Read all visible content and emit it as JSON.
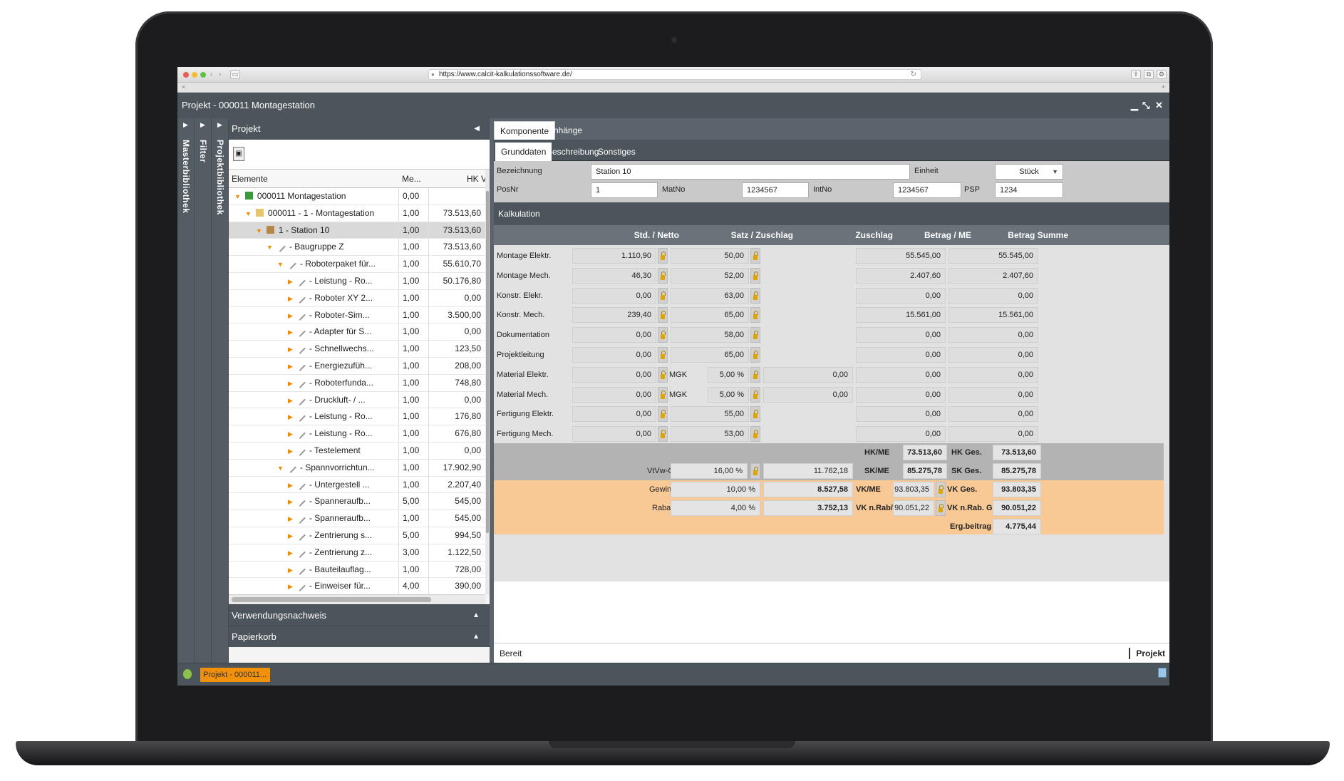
{
  "browser": {
    "url": "https://www.calcit-kalkulationssoftware.de/"
  },
  "window": {
    "title": "Projekt - 000011 Montagestation"
  },
  "side_tabs": [
    "Masterbibliothek",
    "Filter",
    "Projektbibliothek"
  ],
  "left_panel": {
    "title": "Projekt",
    "columns": [
      "Elemente",
      "Me...",
      "HK",
      "V"
    ],
    "rows": [
      {
        "name": "000011 Montagestation",
        "me": "0,00",
        "hk": "",
        "level": 0,
        "expand": "open",
        "icon": "excel-icon"
      },
      {
        "name": "000011 - 1 - Montagestation",
        "me": "1,00",
        "hk": "73.513,60",
        "level": 1,
        "expand": "open",
        "icon": "folder-icon"
      },
      {
        "name": "1 - Station 10",
        "me": "1,00",
        "hk": "73.513,60",
        "level": 2,
        "expand": "open",
        "icon": "station-icon",
        "selected": true
      },
      {
        "name": "- Baugruppe Z",
        "me": "1,00",
        "hk": "73.513,60",
        "level": 3,
        "expand": "open",
        "icon": "wrench-icon"
      },
      {
        "name": "- Roboterpaket für...",
        "me": "1,00",
        "hk": "55.610,70",
        "level": 4,
        "expand": "open",
        "icon": "wrench-icon"
      },
      {
        "name": "- Leistung - Ro...",
        "me": "1,00",
        "hk": "50.176,80",
        "level": 5,
        "expand": "closed",
        "icon": "wrench-icon"
      },
      {
        "name": "- Roboter XY 2...",
        "me": "1,00",
        "hk": "0,00",
        "level": 5,
        "expand": "closed",
        "icon": "wrench-icon"
      },
      {
        "name": "- Roboter-Sim...",
        "me": "1,00",
        "hk": "3.500,00",
        "level": 5,
        "expand": "closed",
        "icon": "wrench-icon"
      },
      {
        "name": "- Adapter für S...",
        "me": "1,00",
        "hk": "0,00",
        "level": 5,
        "expand": "closed",
        "icon": "wrench-icon"
      },
      {
        "name": "- Schnellwechs...",
        "me": "1,00",
        "hk": "123,50",
        "level": 5,
        "expand": "closed",
        "icon": "wrench-icon"
      },
      {
        "name": "- Energiezufüh...",
        "me": "1,00",
        "hk": "208,00",
        "level": 5,
        "expand": "closed",
        "icon": "wrench-icon"
      },
      {
        "name": "- Roboterfunda...",
        "me": "1,00",
        "hk": "748,80",
        "level": 5,
        "expand": "closed",
        "icon": "wrench-icon"
      },
      {
        "name": "- Druckluft- / ...",
        "me": "1,00",
        "hk": "0,00",
        "level": 5,
        "expand": "closed",
        "icon": "wrench-icon"
      },
      {
        "name": "- Leistung - Ro...",
        "me": "1,00",
        "hk": "176,80",
        "level": 5,
        "expand": "closed",
        "icon": "wrench-icon"
      },
      {
        "name": "- Leistung - Ro...",
        "me": "1,00",
        "hk": "676,80",
        "level": 5,
        "expand": "closed",
        "icon": "wrench-icon"
      },
      {
        "name": "- Testelement",
        "me": "1,00",
        "hk": "0,00",
        "level": 5,
        "expand": "closed",
        "icon": "wrench-icon"
      },
      {
        "name": "- Spannvorrichtun...",
        "me": "1,00",
        "hk": "17.902,90",
        "level": 4,
        "expand": "open",
        "icon": "wrench-icon"
      },
      {
        "name": "- Untergestell ...",
        "me": "1,00",
        "hk": "2.207,40",
        "level": 5,
        "expand": "closed",
        "icon": "wrench-icon"
      },
      {
        "name": "- Spanneraufb...",
        "me": "5,00",
        "hk": "545,00",
        "level": 5,
        "expand": "closed",
        "icon": "wrench-icon"
      },
      {
        "name": "- Spanneraufb...",
        "me": "1,00",
        "hk": "545,00",
        "level": 5,
        "expand": "closed",
        "icon": "wrench-icon"
      },
      {
        "name": "- Zentrierung s...",
        "me": "5,00",
        "hk": "994,50",
        "level": 5,
        "expand": "closed",
        "icon": "wrench-icon"
      },
      {
        "name": "- Zentrierung z...",
        "me": "3,00",
        "hk": "1.122,50",
        "level": 5,
        "expand": "closed",
        "icon": "wrench-icon"
      },
      {
        "name": "- Bauteilauflag...",
        "me": "1,00",
        "hk": "728,00",
        "level": 5,
        "expand": "closed",
        "icon": "wrench-icon"
      },
      {
        "name": "- Einweiser für...",
        "me": "4,00",
        "hk": "390,00",
        "level": 5,
        "expand": "closed",
        "icon": "wrench-icon"
      }
    ],
    "accordions": [
      "Verwendungsnachweis",
      "Papierkorb"
    ]
  },
  "tabs_main": [
    "Komponente",
    "Anhänge"
  ],
  "tabs_sub": [
    "Grunddaten",
    "Beschreibung",
    "Sonstiges"
  ],
  "grunddaten": {
    "bezeichnung_label": "Bezeichnung",
    "bezeichnung": "Station 10",
    "einheit_label": "Einheit",
    "einheit": "Stück",
    "posnr_label": "PosNr",
    "posnr": "1",
    "matno_label": "MatNo",
    "matno": "1234567",
    "intno_label": "IntNo",
    "intno": "1234567",
    "psp_label": "PSP",
    "psp": "1234"
  },
  "kalkulation": {
    "title": "Kalkulation",
    "headers": [
      "Std. / Netto",
      "Satz / Zuschlag",
      "Zuschlag",
      "Betrag / ME",
      "Betrag Summe"
    ],
    "rows": [
      {
        "label": "Montage Elektr.",
        "std": "1.110,90",
        "satz": "50,00",
        "zuschlag": "",
        "betrag": "55.545,00",
        "summe": "55.545,00"
      },
      {
        "label": "Montage Mech.",
        "std": "46,30",
        "satz": "52,00",
        "zuschlag": "",
        "betrag": "2.407,60",
        "summe": "2.407,60"
      },
      {
        "label": "Konstr. Elekr.",
        "std": "0,00",
        "satz": "63,00",
        "zuschlag": "",
        "betrag": "0,00",
        "summe": "0,00"
      },
      {
        "label": "Konstr. Mech.",
        "std": "239,40",
        "satz": "65,00",
        "zuschlag": "",
        "betrag": "15.561,00",
        "summe": "15.561,00"
      },
      {
        "label": "Dokumentation",
        "std": "0,00",
        "satz": "58,00",
        "zuschlag": "",
        "betrag": "0,00",
        "summe": "0,00"
      },
      {
        "label": "Projektleitung",
        "std": "0,00",
        "satz": "65,00",
        "zuschlag": "",
        "betrag": "0,00",
        "summe": "0,00"
      },
      {
        "label": "Material Elektr.",
        "std": "0,00",
        "mgk": "MGK",
        "satz": "5,00 %",
        "zuschlag": "0,00",
        "betrag": "0,00",
        "summe": "0,00"
      },
      {
        "label": "Material Mech.",
        "std": "0,00",
        "mgk": "MGK",
        "satz": "5,00 %",
        "zuschlag": "0,00",
        "betrag": "0,00",
        "summe": "0,00"
      },
      {
        "label": "Fertigung Elektr.",
        "std": "0,00",
        "satz": "55,00",
        "zuschlag": "",
        "betrag": "0,00",
        "summe": "0,00"
      },
      {
        "label": "Fertigung Mech.",
        "std": "0,00",
        "satz": "53,00",
        "zuschlag": "",
        "betrag": "0,00",
        "summe": "0,00"
      }
    ],
    "summary": {
      "hk_me_label": "HK/ME",
      "hk_me": "73.513,60",
      "hk_ges_label": "HK Ges.",
      "hk_ges": "73.513,60",
      "vtvw_label": "VtVw-GK",
      "vtvw_pct": "16,00 %",
      "vtvw_val": "11.762,18",
      "sk_me_label": "SK/ME",
      "sk_me": "85.275,78",
      "sk_ges_label": "SK Ges.",
      "sk_ges": "85.275,78",
      "gewinn_label": "Gewinn",
      "gewinn_pct": "10,00 %",
      "gewinn_val": "8.527,58",
      "vk_me_label": "VK/ME",
      "vk_me": "93.803,35",
      "vk_ges_label": "VK Ges.",
      "vk_ges": "93.803,35",
      "rabatt_label": "Rabatt",
      "rabatt_pct": "4,00 %",
      "rabatt_val": "3.752,13",
      "vk_nrab_label": "VK n.Rab/ME",
      "vk_nrab": "90.051,22",
      "vk_nrab_ges_label": "VK n.Rab. Ges.",
      "vk_nrab_ges": "90.051,22",
      "erg_label": "Erg.beitrag",
      "erg": "4.775,44"
    }
  },
  "status": {
    "text": "Bereit",
    "right": "Projekt"
  },
  "taskbar": {
    "item": "Projekt - 000011..."
  },
  "colors": {
    "accent": "#f0900b",
    "app_bg": "#5b646d",
    "orange_panel": "#f8c995"
  }
}
